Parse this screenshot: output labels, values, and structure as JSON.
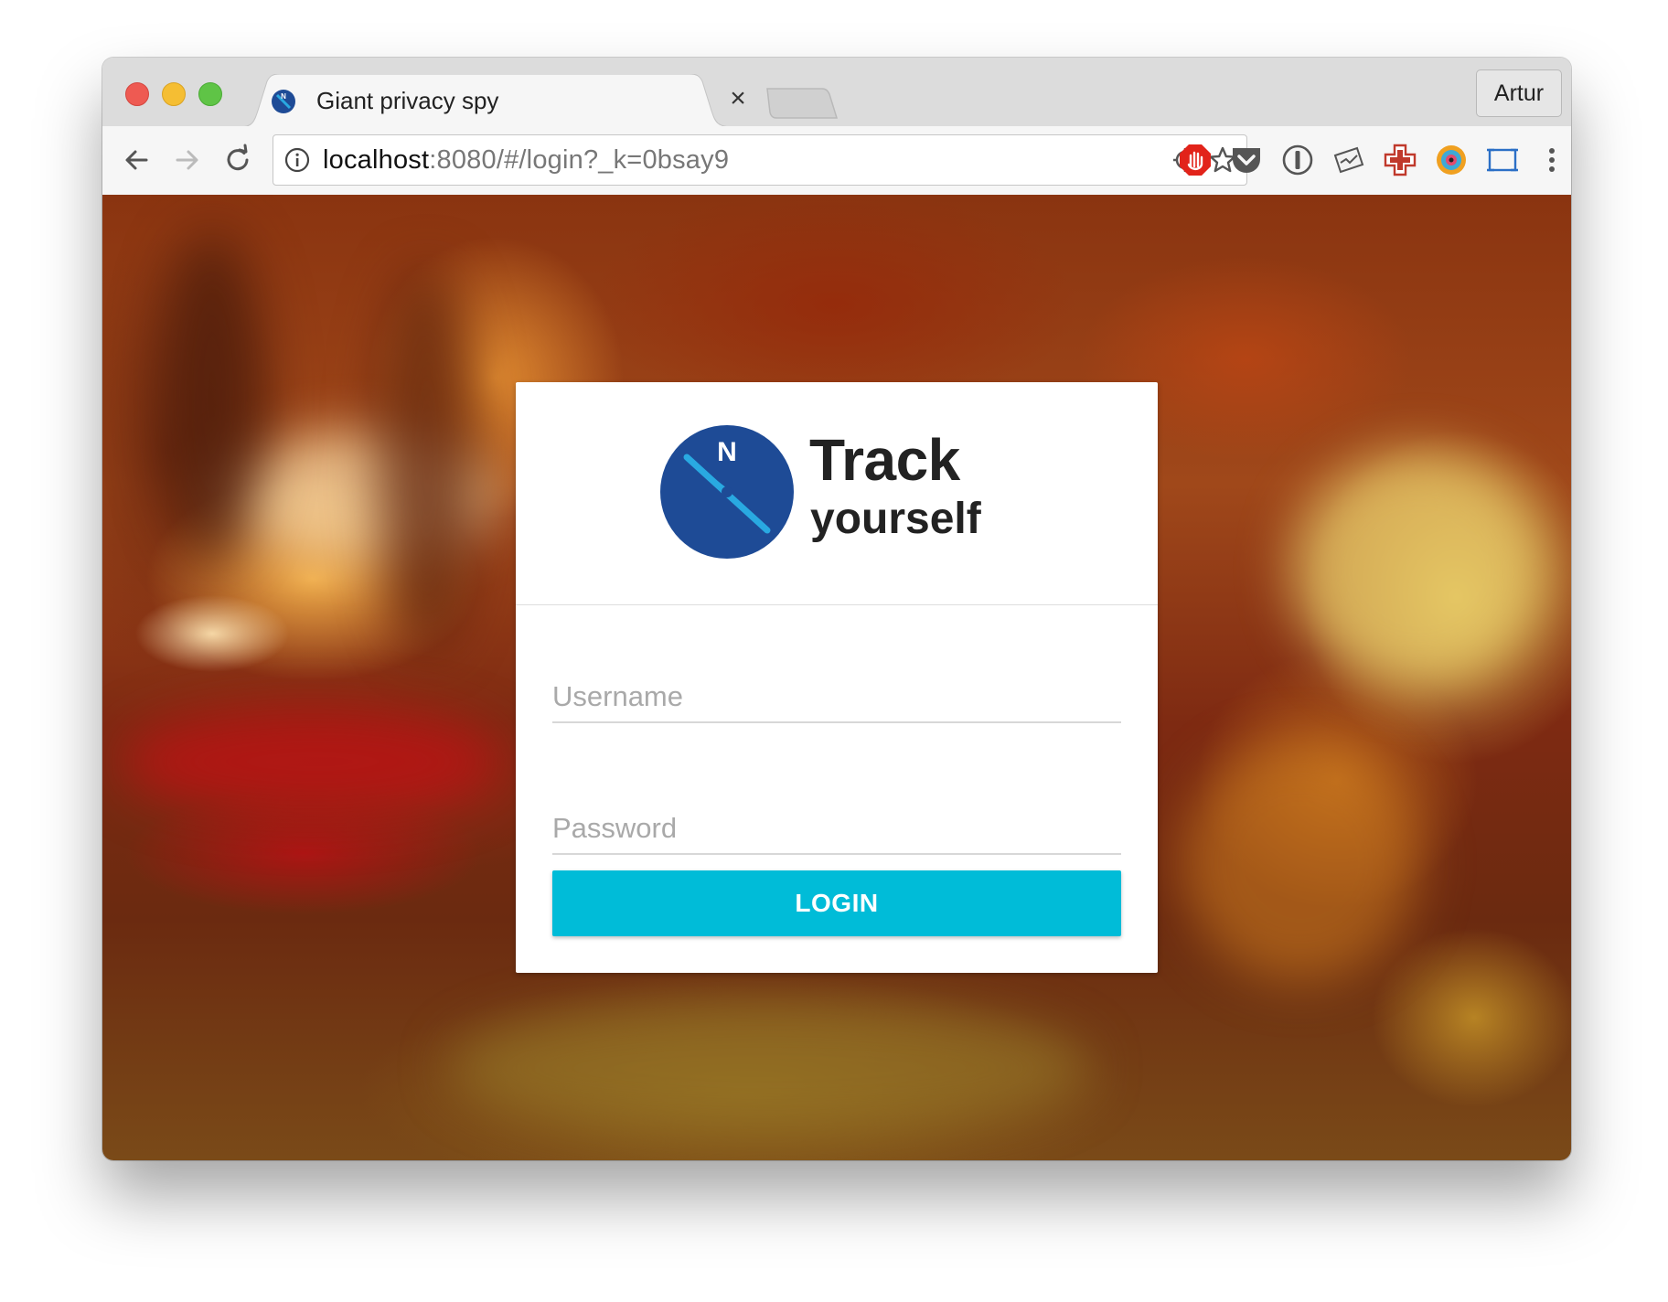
{
  "browser": {
    "tab": {
      "title": "Giant privacy spy",
      "close_glyph": "×",
      "favicon": "compass-icon"
    },
    "profile_name": "Artur",
    "address_bar": {
      "host": "localhost",
      "rest": ":8080/#/login?_k=0bsay9"
    },
    "nav_icons": [
      "back-arrow-icon",
      "forward-arrow-icon",
      "reload-icon"
    ],
    "extension_icons": [
      "adblock-icon",
      "pocket-icon",
      "onepassword-icon",
      "form-filler-icon",
      "add-tab-icon",
      "color-picker-icon",
      "screenshot-icon",
      "chrome-menu-icon"
    ],
    "colors": {
      "tab_strip": "#dcdcdc",
      "toolbar": "#f6f6f6"
    }
  },
  "login": {
    "brand_line1": "Track",
    "brand_line2": "yourself",
    "username_placeholder": "Username",
    "password_placeholder": "Password",
    "button_label": "LOGIN",
    "logo_letter": "N",
    "colors": {
      "accent": "#00bcd8",
      "logo": "#1e4b96",
      "needle": "#29a9e1"
    }
  }
}
